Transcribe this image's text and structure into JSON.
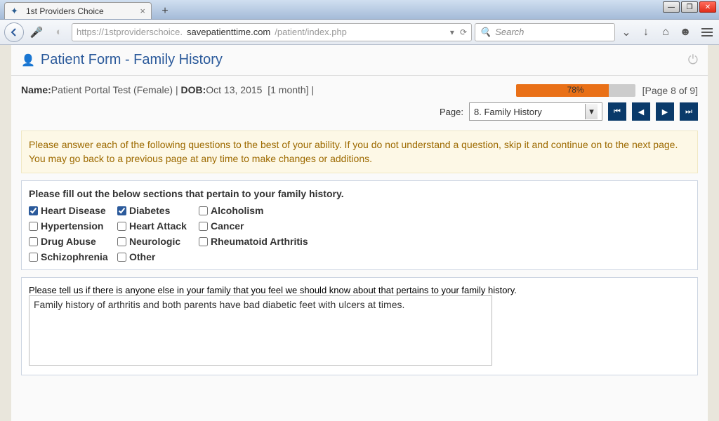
{
  "browser": {
    "tab_title": "1st Providers Choice",
    "url_prefix": "https://1stproviderschoice.",
    "url_host": "savepatienttime.com",
    "url_path": "/patient/index.php",
    "search_placeholder": "Search"
  },
  "header": {
    "title": "Patient Form - Family History"
  },
  "patient": {
    "name_label": "Name:",
    "name": "Patient Portal Test (Female)",
    "dob_label": "DOB:",
    "dob": "Oct 13, 2015",
    "age": "[1 month]"
  },
  "progress": {
    "percent": 78,
    "percent_label": "78%",
    "page_label": "[Page 8 of 9]"
  },
  "pager": {
    "label": "Page:",
    "selected": "8. Family History"
  },
  "notice": "Please answer each of the following questions to the best of your ability. If you do not understand a question, skip it and continue on to the next page. You may go back to a previous page at any time to make changes or additions.",
  "family_history": {
    "title": "Please fill out the below sections that pertain to your family history.",
    "items": [
      {
        "label": "Heart Disease",
        "checked": true
      },
      {
        "label": "Diabetes",
        "checked": true
      },
      {
        "label": "Alcoholism",
        "checked": false
      },
      {
        "label": "Hypertension",
        "checked": false
      },
      {
        "label": "Heart Attack",
        "checked": false
      },
      {
        "label": "Cancer",
        "checked": false
      },
      {
        "label": "Drug Abuse",
        "checked": false
      },
      {
        "label": "Neurologic",
        "checked": false
      },
      {
        "label": "Rheumatoid Arthritis",
        "checked": false
      },
      {
        "label": "Schizophrenia",
        "checked": false
      },
      {
        "label": "Other",
        "checked": false
      }
    ]
  },
  "additional": {
    "title": "Please tell us if there is anyone else in your family that you feel we should know about that pertains to your family history.",
    "text": "Family history of arthritis and both parents have bad diabetic feet with ulcers at times."
  }
}
